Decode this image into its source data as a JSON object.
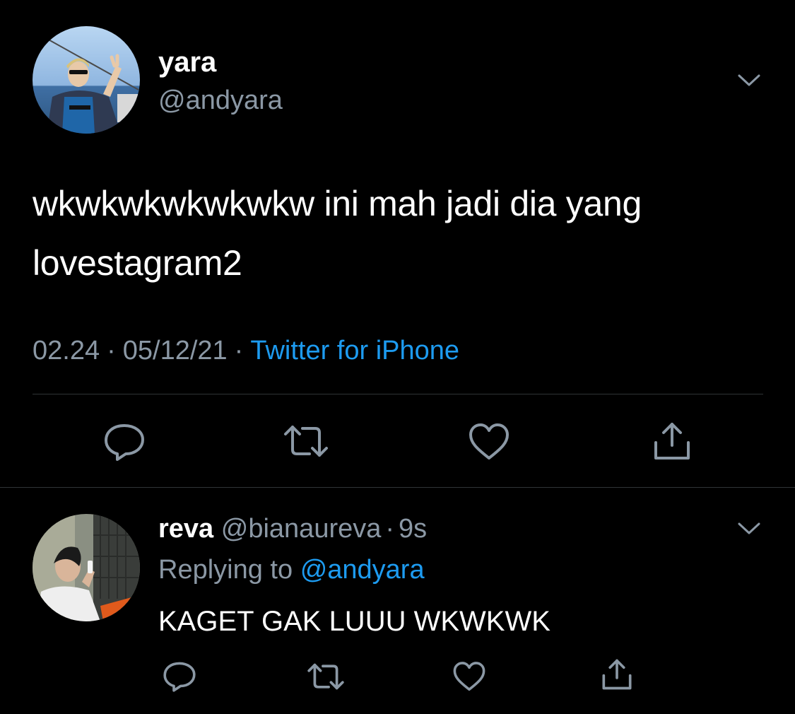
{
  "main_tweet": {
    "display_name": "yara",
    "handle": "@andyara",
    "text": "wkwkwkwkwkwkw ini mah jadi dia yang lovestagram2",
    "time": "02.24",
    "date": "05/12/21",
    "separator": "·",
    "source": "Twitter for iPhone",
    "actions": [
      "reply-icon",
      "retweet-icon",
      "like-icon",
      "share-icon"
    ]
  },
  "reply": {
    "display_name": "reva",
    "handle": "@bianaureva",
    "separator": "·",
    "time": "9s",
    "replying_to_label": "Replying to",
    "replying_to_handle": "@andyara",
    "text": "KAGET GAK LUUU WKWKWK",
    "actions": [
      "reply-icon",
      "retweet-icon",
      "like-icon",
      "share-icon"
    ]
  },
  "colors": {
    "background": "#000000",
    "primary_text": "#ffffff",
    "secondary_text": "#8b98a5",
    "accent": "#1d9bf0",
    "divider": "#2f3336"
  }
}
